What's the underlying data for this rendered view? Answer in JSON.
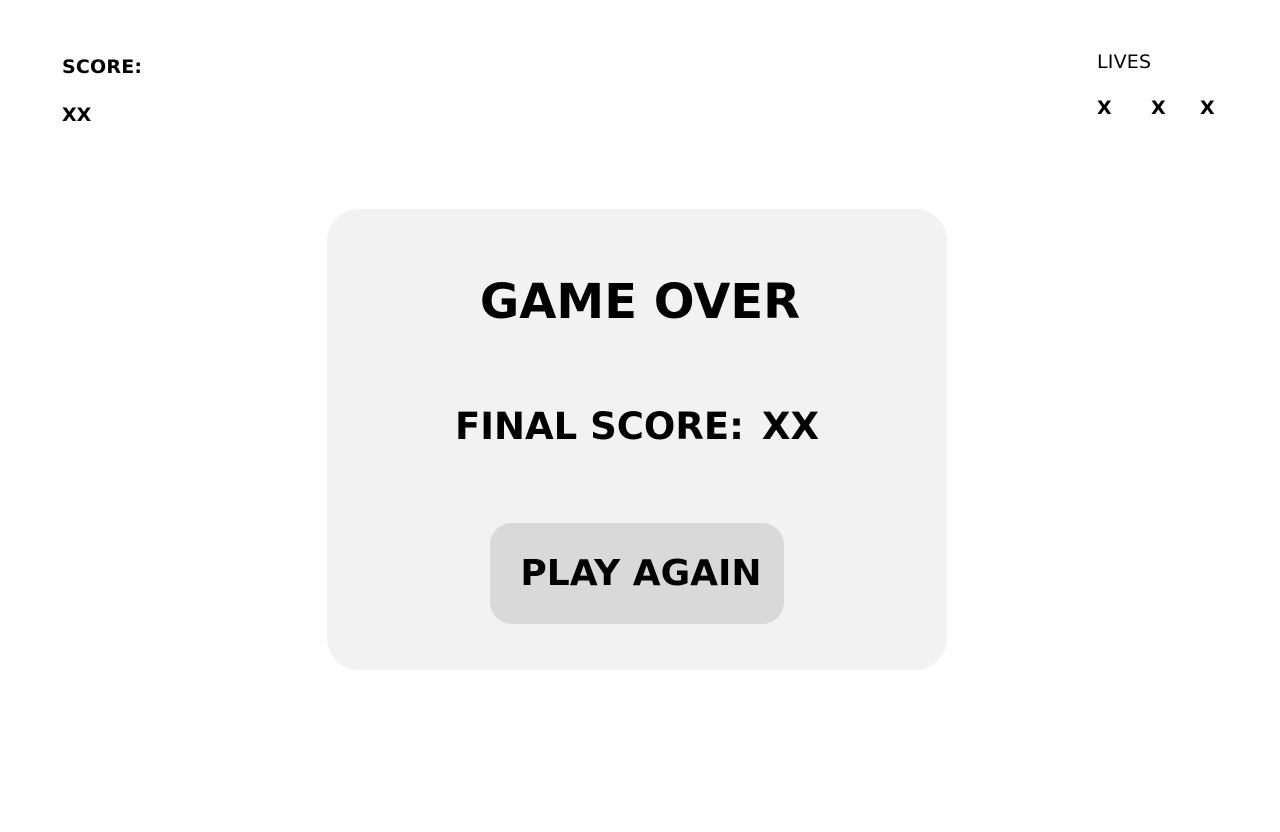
{
  "hud": {
    "score_label": "SCORE:",
    "score_value": "XX",
    "lives_label": "LIVES",
    "lives": [
      "X",
      "X",
      "X"
    ]
  },
  "game_over": {
    "title": "GAME OVER",
    "final_score_label": "FINAL SCORE:",
    "final_score_value": "XX",
    "play_again_label": "PLAY AGAIN"
  },
  "colors": {
    "background": "#ffffff",
    "card": "#f2f2f2",
    "button": "#d9d9d9",
    "text": "#000000"
  }
}
